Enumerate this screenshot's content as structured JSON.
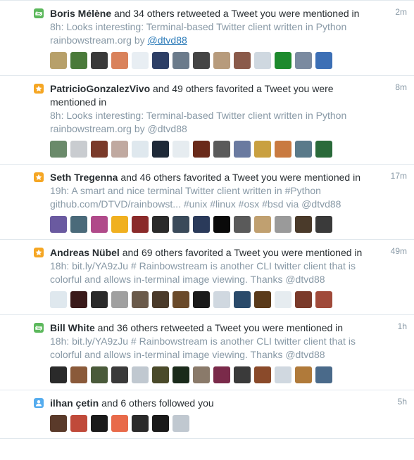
{
  "notifications": [
    {
      "type": "retweet",
      "badge_icon": "retweet-icon",
      "badge_color": "#5cb85c",
      "name": "Boris Mélène",
      "action": " and 34 others retweeted a Tweet you were mentioned in",
      "time": "2m",
      "tweet_prefix": "8h: Looks interesting: Terminal-based Twitter client written in Python rainbowstream.org by ",
      "tweet_link": "@dtvd88",
      "avatar_colors": [
        "#b7a06a",
        "#4a7a3a",
        "#3a3a3a",
        "#d9825b",
        "#e8eef3",
        "#2d3f66",
        "#6b7b8b",
        "#444",
        "#b79b7c",
        "#8a5a4a",
        "#cfd8e0",
        "#1d8a2d",
        "#7a8aa0",
        "#3c6fb5"
      ]
    },
    {
      "type": "favorite",
      "badge_icon": "star-icon",
      "badge_color": "#f5a623",
      "name": "PatricioGonzalezVivo",
      "action": " and 49 others favorited a Tweet you were mentioned in",
      "time": "8m",
      "tweet_prefix": "8h: Looks interesting: Terminal-based Twitter client written in Python rainbowstream.org by ",
      "tweet_link": "@dtvd88",
      "avatar_colors": [
        "#6a8a6a",
        "#c9ccd0",
        "#7a3a2a",
        "#c0a9a0",
        "#dfe8ee",
        "#1f2a38",
        "#e6ecf0",
        "#6a2a1a",
        "#5a5a5a",
        "#6a7aa0",
        "#c9a040",
        "#c97a40",
        "#5a7a8a",
        "#2a6a3a"
      ]
    },
    {
      "type": "favorite",
      "badge_icon": "star-icon",
      "badge_color": "#f5a623",
      "name": "Seth Tregenna",
      "action": " and 46 others favorited a Tweet you were mentioned in",
      "time": "17m",
      "tweet_prefix": "19h: A smart and nice terminal Twitter client written in ",
      "tweet_hl1": "#Python",
      "tweet_mid": " github.com/DTVD/rainbowst... ",
      "tweet_hl2": "#unix #linux #osx #bsd",
      "tweet_mid2": " via ",
      "tweet_link": "@dtvd88",
      "avatar_colors": [
        "#6a5aa0",
        "#4a6a7a",
        "#b04a8a",
        "#f0b020",
        "#8a2a2a",
        "#2a2a2a",
        "#3a4a5a",
        "#2a3a5a",
        "#0a0a0a",
        "#5a5a5a",
        "#c0a070",
        "#9a9a9a",
        "#4a3a2a",
        "#3a3a3a"
      ]
    },
    {
      "type": "favorite",
      "badge_icon": "star-icon",
      "badge_color": "#f5a623",
      "name": "Andreas Nübel",
      "action": " and 69 others favorited a Tweet you were mentioned in",
      "time": "49m",
      "tweet_prefix": "18h: bit.ly/YA9zJu # Rainbowstream is another CLI twitter client that is colorful and allows in-terminal image viewing. Thanks ",
      "tweet_link": "@dtvd88",
      "avatar_colors": [
        "#dfe8ee",
        "#3a1a1a",
        "#2a2a2a",
        "#a0a0a0",
        "#6a5a4a",
        "#4a3a2a",
        "#6a4a2a",
        "#1a1a1a",
        "#d0d8e0",
        "#2a4a6a",
        "#5a3a1a",
        "#e6ecf0",
        "#7a3a2a",
        "#a04a3a"
      ]
    },
    {
      "type": "retweet",
      "badge_icon": "retweet-icon",
      "badge_color": "#5cb85c",
      "name": "Bill White",
      "action": " and 36 others retweeted a Tweet you were mentioned in",
      "time": "1h",
      "tweet_prefix": "18h: bit.ly/YA9zJu # Rainbowstream is another CLI twitter client that is colorful and allows in-terminal image viewing. Thanks ",
      "tweet_link": "@dtvd88",
      "avatar_colors": [
        "#2a2a2a",
        "#8a5a3a",
        "#4a5a3a",
        "#3a3a3a",
        "#c0c8d0",
        "#4a4a2a",
        "#1a2a1a",
        "#8a7a6a",
        "#7a2a4a",
        "#3a3a3a",
        "#8a4a2a",
        "#d0d8e0",
        "#b07a3a",
        "#4a6a8a"
      ]
    },
    {
      "type": "follow",
      "badge_icon": "person-icon",
      "badge_color": "#55acee",
      "name": "ilhan çetin",
      "action": " and 6 others followed you",
      "time": "5h",
      "avatar_colors": [
        "#5a3a2a",
        "#c04a3a",
        "#1a1a1a",
        "#e86a4a",
        "#2a2a2a",
        "#1a1a1a",
        "#c0c8d0"
      ]
    }
  ]
}
